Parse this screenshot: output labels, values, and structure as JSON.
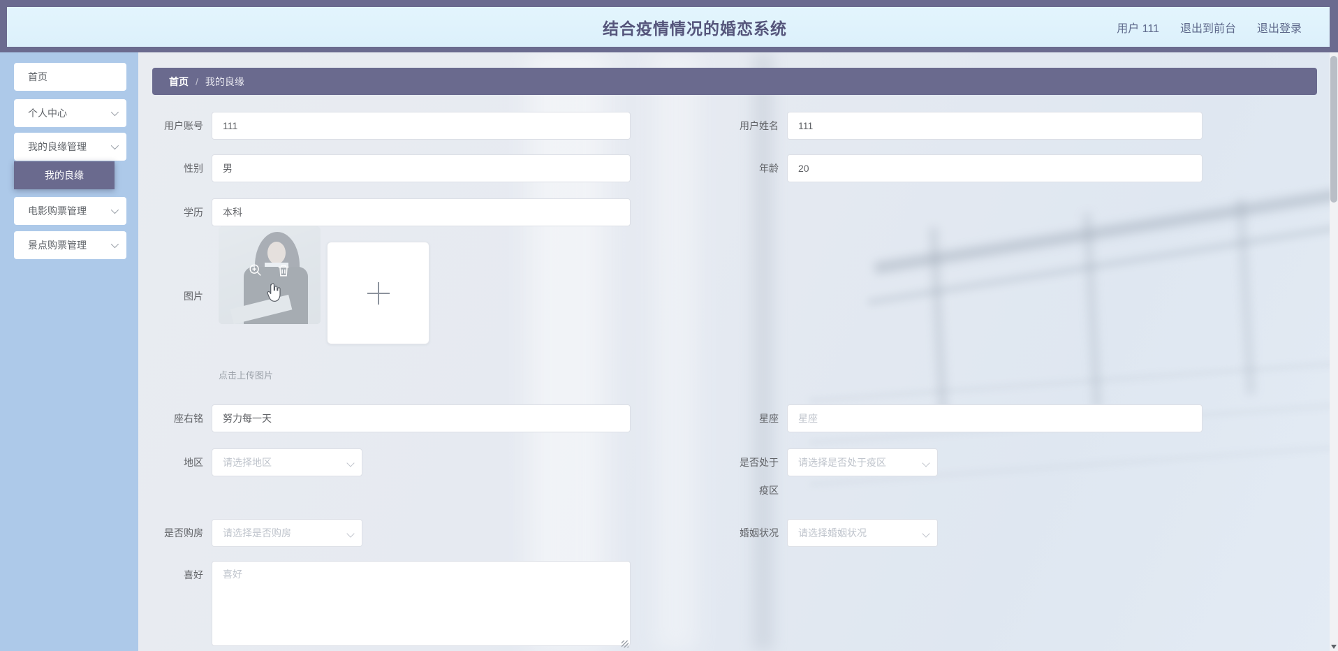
{
  "header": {
    "title": "结合疫情情况的婚恋系统",
    "user_label": "用户 111",
    "exit_front_label": "退出到前台",
    "logout_label": "退出登录"
  },
  "sidebar": {
    "items": [
      {
        "label": "首页"
      },
      {
        "label": "个人中心"
      },
      {
        "label": "我的良缘管理"
      },
      {
        "label": "我的良缘",
        "selected": true
      },
      {
        "label": "电影购票管理"
      },
      {
        "label": "景点购票管理"
      }
    ]
  },
  "breadcrumb": {
    "root": "首页",
    "separator": "/",
    "current": "我的良缘"
  },
  "form": {
    "account": {
      "label": "用户账号",
      "value": "111"
    },
    "name": {
      "label": "用户姓名",
      "value": "111"
    },
    "gender": {
      "label": "性别",
      "value": "男"
    },
    "age": {
      "label": "年龄",
      "value": "20"
    },
    "education": {
      "label": "学历",
      "value": "本科"
    },
    "photo": {
      "label": "图片",
      "hint": "点击上传图片"
    },
    "motto": {
      "label": "座右铭",
      "value": "努力每一天"
    },
    "constellation": {
      "label": "星座",
      "placeholder": "星座"
    },
    "region": {
      "label": "地区",
      "placeholder": "请选择地区"
    },
    "epidemic": {
      "label": "是否处于疫区",
      "placeholder": "请选择是否处于疫区"
    },
    "house": {
      "label": "是否购房",
      "placeholder": "请选择是否购房"
    },
    "marriage": {
      "label": "婚姻状况",
      "placeholder": "请选择婚姻状况"
    },
    "hobby": {
      "label": "喜好",
      "placeholder": "喜好"
    }
  },
  "icons": {
    "zoom_in": "zoom-in-icon",
    "delete": "trash-icon",
    "plus": "plus-icon",
    "chevron": "chevron-down-icon"
  },
  "colors": {
    "frame_purple": "#6b6b8f",
    "header_bg": "#dff2fc",
    "sidebar_bg": "#adc9e9",
    "selected_item_bg": "#6a6a8e",
    "input_border": "#dcdfe6",
    "placeholder": "#bfc4cc"
  }
}
